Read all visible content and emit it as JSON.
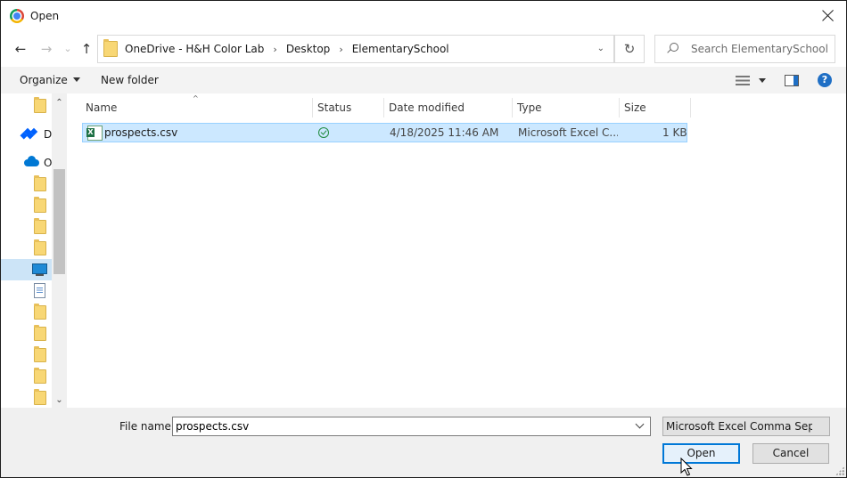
{
  "window": {
    "title": "Open"
  },
  "nav": {
    "back": "←",
    "forward": "→",
    "recent": "⌄",
    "up": "↑",
    "breadcrumb": [
      "OneDrive - H&H Color Lab",
      "Desktop",
      "ElementarySchool"
    ],
    "separator": "›",
    "address_dropdown": "⌄",
    "refresh": "↻",
    "search_placeholder": "Search ElementarySchool"
  },
  "toolbar": {
    "organize": "Organize",
    "new_folder": "New folder",
    "help": "?"
  },
  "sidebar": {
    "items": [
      {
        "type": "folder",
        "label": ""
      },
      {
        "type": "dropbox",
        "label": "D"
      },
      {
        "type": "onedrive",
        "label": "O"
      },
      {
        "type": "folder",
        "label": ""
      },
      {
        "type": "folder",
        "label": ""
      },
      {
        "type": "folder",
        "label": ""
      },
      {
        "type": "folder",
        "label": ""
      },
      {
        "type": "desktop",
        "label": "",
        "selected": true
      },
      {
        "type": "document",
        "label": ""
      },
      {
        "type": "folder",
        "label": ""
      },
      {
        "type": "folder",
        "label": ""
      },
      {
        "type": "folder",
        "label": ""
      },
      {
        "type": "folder",
        "label": ""
      },
      {
        "type": "folder",
        "label": ""
      }
    ],
    "scroll_up": "⌃",
    "scroll_down": "⌄"
  },
  "columns": {
    "name": "Name",
    "status": "Status",
    "date_modified": "Date modified",
    "type": "Type",
    "size": "Size",
    "sort_indicator": "^"
  },
  "files": [
    {
      "name": "prospects.csv",
      "date_modified": "4/18/2025 11:46 AM",
      "type": "Microsoft Excel C...",
      "size": "1 KB",
      "selected": true
    }
  ],
  "footer": {
    "file_name_label": "File name:",
    "file_name_value": "prospects.csv",
    "file_type": "Microsoft Excel Comma Separated Values File",
    "open": "Open",
    "cancel": "Cancel"
  },
  "colors": {
    "accent": "#0078d7",
    "selection": "#cce8ff",
    "status_ok": "#1e8a3c"
  }
}
